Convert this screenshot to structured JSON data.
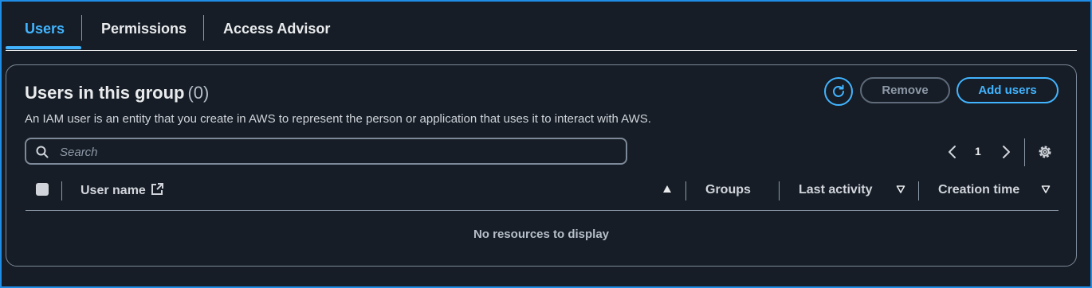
{
  "tabs": [
    {
      "label": "Users",
      "active": true
    },
    {
      "label": "Permissions",
      "active": false
    },
    {
      "label": "Access Advisor",
      "active": false
    }
  ],
  "card": {
    "title": "Users in this group",
    "count": "(0)",
    "description": "An IAM user is an entity that you create in AWS to represent the person or application that uses it to interact with AWS."
  },
  "actions": {
    "refresh_icon": "refresh-icon",
    "remove_label": "Remove",
    "add_label": "Add users"
  },
  "search": {
    "placeholder": "Search",
    "value": ""
  },
  "pagination": {
    "current_page": "1"
  },
  "table": {
    "columns": [
      "User name",
      "Groups",
      "Last activity",
      "Creation time"
    ],
    "empty_text": "No resources to display"
  },
  "colors": {
    "accent": "#42b4ff",
    "background": "#161d26",
    "border": "#7d8998"
  }
}
